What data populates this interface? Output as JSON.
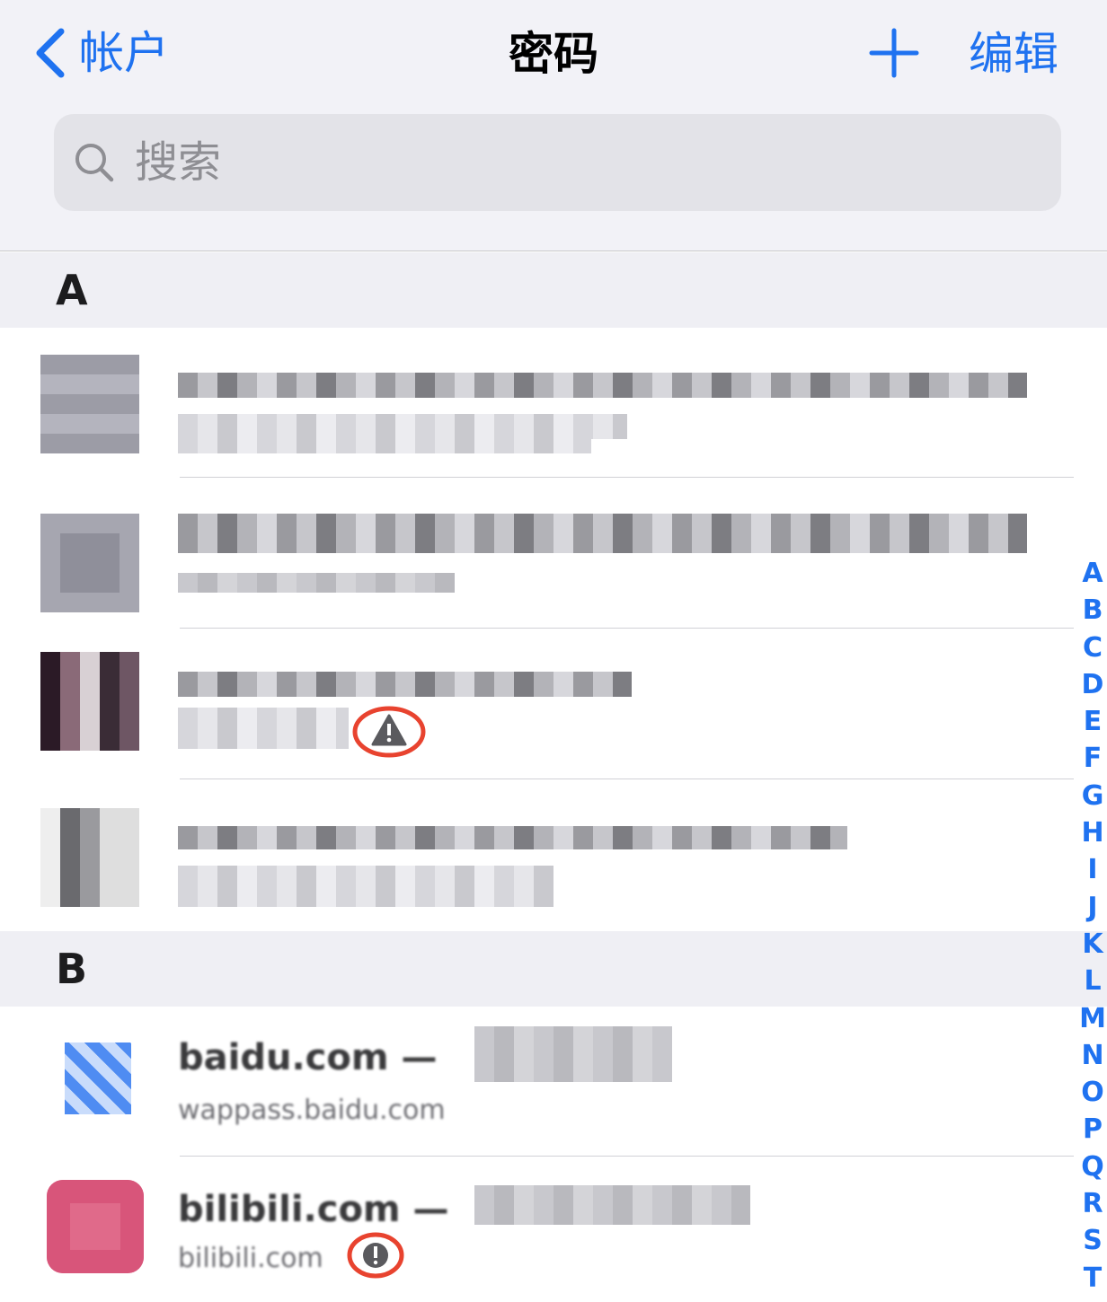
{
  "nav": {
    "back_label": "帐户",
    "title": "密码",
    "add_label": "+",
    "edit_label": "编辑"
  },
  "search": {
    "placeholder": "搜索"
  },
  "colors": {
    "accent": "#1f72f0",
    "warning_ring": "#e8432f",
    "header_bg": "#f2f2f7",
    "section_bg": "#efeff4"
  },
  "sections": [
    {
      "letter": "A"
    },
    {
      "letter": "B"
    }
  ],
  "rows_b": [
    {
      "title": "baidu.com —",
      "subtitle": "wappass.baidu.com"
    },
    {
      "title": "bilibili.com —",
      "subtitle": "bilibili.com"
    }
  ],
  "icons": {
    "back": "chevron-left-icon",
    "add": "plus-icon",
    "search": "magnifier-icon",
    "warning": "warning-triangle-icon"
  },
  "index_letters": [
    "A",
    "B",
    "C",
    "D",
    "E",
    "F",
    "G",
    "H",
    "I",
    "J",
    "K",
    "L",
    "M",
    "N",
    "O",
    "P",
    "Q",
    "R",
    "S",
    "T"
  ]
}
